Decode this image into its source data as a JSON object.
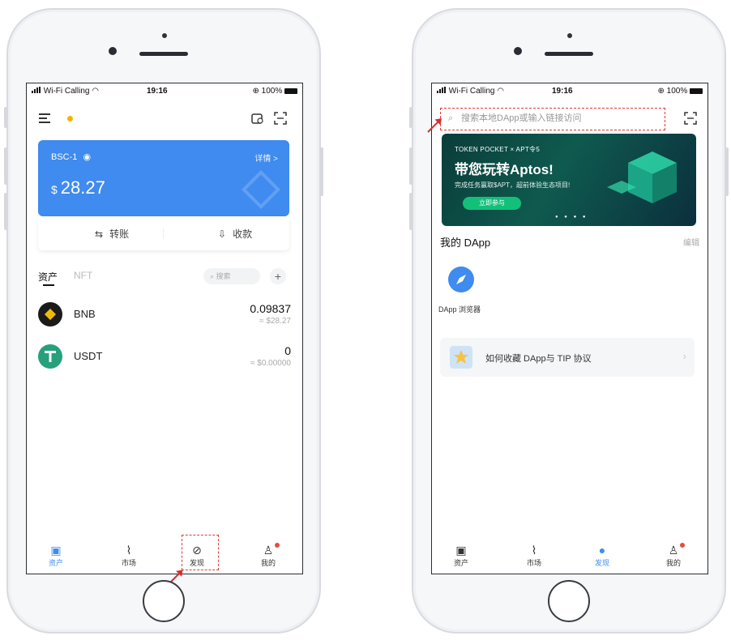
{
  "status": {
    "carrier": "Wi-Fi Calling",
    "time": "19:16",
    "battery": "100%"
  },
  "left": {
    "wallet": {
      "network": "BSC-1",
      "detail": "详情 >",
      "currency": "$",
      "balance": "28.27"
    },
    "actions": {
      "transfer": "转账",
      "receive": "收款"
    },
    "tabs": {
      "assets": "资产",
      "nft": "NFT"
    },
    "search_placeholder": "搜索",
    "tokens": [
      {
        "name": "BNB",
        "amount": "0.09837",
        "fiat": "≈ $28.27"
      },
      {
        "name": "USDT",
        "amount": "0",
        "fiat": "≈ $0.00000"
      }
    ],
    "tabbar": [
      {
        "label": "资产",
        "icon": "wallet-icon"
      },
      {
        "label": "市场",
        "icon": "chart-icon"
      },
      {
        "label": "发现",
        "icon": "compass-icon"
      },
      {
        "label": "我的",
        "icon": "profile-icon"
      }
    ]
  },
  "right": {
    "search_placeholder": "搜索本地DApp或输入链接访问",
    "banner": {
      "brand": "TOKEN POCKET × APT令5",
      "title": "带您玩转Aptos!",
      "subtitle": "完成任务赢取$APT，超前体验生态项目!",
      "cta": "立即参与"
    },
    "my_dapp": {
      "title": "我的 DApp",
      "edit": "编辑"
    },
    "dapp_browser_label": "DApp 浏览器",
    "tip_card": "如何收藏 DApp与 TIP 协议",
    "tabbar": [
      {
        "label": "资产",
        "icon": "tp-icon"
      },
      {
        "label": "市场",
        "icon": "chart-icon"
      },
      {
        "label": "发现",
        "icon": "compass-icon"
      },
      {
        "label": "我的",
        "icon": "profile-icon"
      }
    ]
  },
  "colors": {
    "accent": "#3f8bf0",
    "annotation": "#e53935",
    "banner": "#0f5a4f"
  }
}
